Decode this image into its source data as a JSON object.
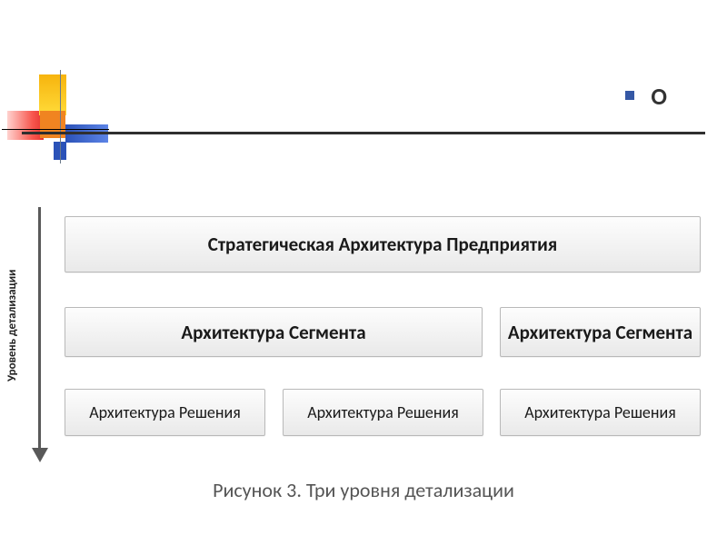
{
  "header": {
    "bullet_marker": "O"
  },
  "chart_data": {
    "type": "bar",
    "title": "Рисунок 3. Три уровня детализации",
    "ylabel": "Уровень детализации",
    "levels": [
      {
        "level": 1,
        "boxes": [
          "Стратегическая Архитектура Предприятия"
        ]
      },
      {
        "level": 2,
        "boxes": [
          "Архитектура Сегмента",
          "Архитектура Сегмента"
        ]
      },
      {
        "level": 3,
        "boxes": [
          "Архитектура Решения",
          "Архитектура Решения",
          "Архитектура Решения"
        ]
      }
    ]
  }
}
